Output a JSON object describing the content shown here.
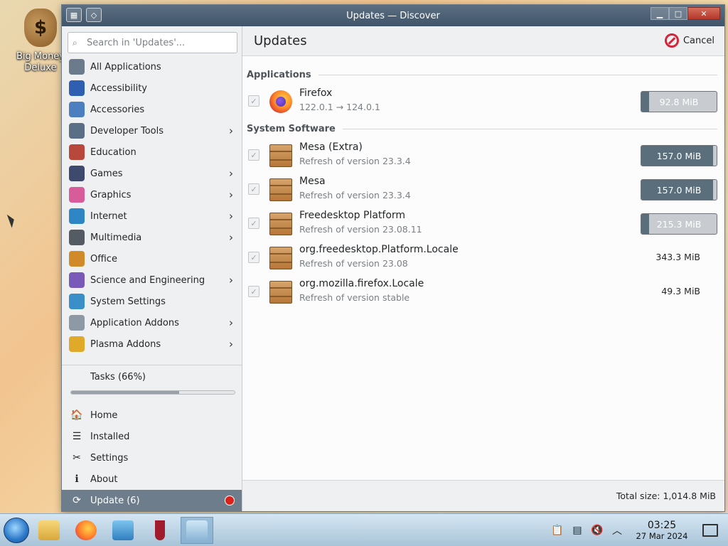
{
  "desktop": {
    "icon_label": "Big Money Deluxe"
  },
  "window": {
    "title": "Updates — Discover"
  },
  "sidebar": {
    "search_placeholder": "Search in 'Updates'...",
    "categories": [
      {
        "label": "All Applications",
        "icon": "grid-icon",
        "color": "#6b7b8c",
        "submenu": false
      },
      {
        "label": "Accessibility",
        "icon": "accessibility-icon",
        "color": "#2f5fb0",
        "submenu": false
      },
      {
        "label": "Accessories",
        "icon": "accessories-icon",
        "color": "#4c7fc0",
        "submenu": false
      },
      {
        "label": "Developer Tools",
        "icon": "developer-tools-icon",
        "color": "#5a6f86",
        "submenu": true
      },
      {
        "label": "Education",
        "icon": "education-icon",
        "color": "#b8473c",
        "submenu": false
      },
      {
        "label": "Games",
        "icon": "games-icon",
        "color": "#3d4a6e",
        "submenu": true
      },
      {
        "label": "Graphics",
        "icon": "graphics-icon",
        "color": "#d85b9a",
        "submenu": true
      },
      {
        "label": "Internet",
        "icon": "internet-icon",
        "color": "#2e86c4",
        "submenu": true
      },
      {
        "label": "Multimedia",
        "icon": "multimedia-icon",
        "color": "#555b62",
        "submenu": true
      },
      {
        "label": "Office",
        "icon": "office-icon",
        "color": "#d08a2a",
        "submenu": false
      },
      {
        "label": "Science and Engineering",
        "icon": "science-icon",
        "color": "#7a5ab8",
        "submenu": true
      },
      {
        "label": "System Settings",
        "icon": "system-settings-icon",
        "color": "#3b8fc8",
        "submenu": false
      },
      {
        "label": "Application Addons",
        "icon": "application-addons-icon",
        "color": "#8d9aa6",
        "submenu": true
      },
      {
        "label": "Plasma Addons",
        "icon": "plasma-addons-icon",
        "color": "#e0a92a",
        "submenu": true
      }
    ],
    "tasks": {
      "label": "Tasks (66%)",
      "progress": 0.66
    },
    "nav": [
      {
        "label": "Home",
        "icon": "home-icon",
        "active": false
      },
      {
        "label": "Installed",
        "icon": "installed-icon",
        "active": false
      },
      {
        "label": "Settings",
        "icon": "settings-icon",
        "active": false
      },
      {
        "label": "About",
        "icon": "about-icon",
        "active": false
      },
      {
        "label": "Update (6)",
        "icon": "update-icon",
        "active": true
      }
    ]
  },
  "main": {
    "title": "Updates",
    "cancel_label": "Cancel",
    "sections": [
      {
        "title": "Applications",
        "items": [
          {
            "name": "Firefox",
            "sub": "122.0.1 → 124.0.1",
            "size": "92.8 MiB",
            "icon": "firefox-icon",
            "progress": 0.1
          }
        ]
      },
      {
        "title": "System Software",
        "items": [
          {
            "name": "Mesa (Extra)",
            "sub": "Refresh of version 23.3.4",
            "size": "157.0 MiB",
            "icon": "package-icon",
            "progress": 0.95
          },
          {
            "name": "Mesa",
            "sub": "Refresh of version 23.3.4",
            "size": "157.0 MiB",
            "icon": "package-icon",
            "progress": 0.95
          },
          {
            "name": "Freedesktop Platform",
            "sub": "Refresh of version 23.08.11",
            "size": "215.3 MiB",
            "icon": "package-icon",
            "progress": 0.1
          },
          {
            "name": "org.freedesktop.Platform.Locale",
            "sub": "Refresh of version 23.08",
            "size": "343.3 MiB",
            "icon": "package-icon",
            "progress": null
          },
          {
            "name": "org.mozilla.firefox.Locale",
            "sub": "Refresh of version stable",
            "size": "49.3 MiB",
            "icon": "package-icon",
            "progress": null
          }
        ]
      }
    ],
    "total_size": "Total size: 1,014.8 MiB"
  },
  "taskbar": {
    "time": "03:25",
    "date": "27 Mar 2024"
  }
}
